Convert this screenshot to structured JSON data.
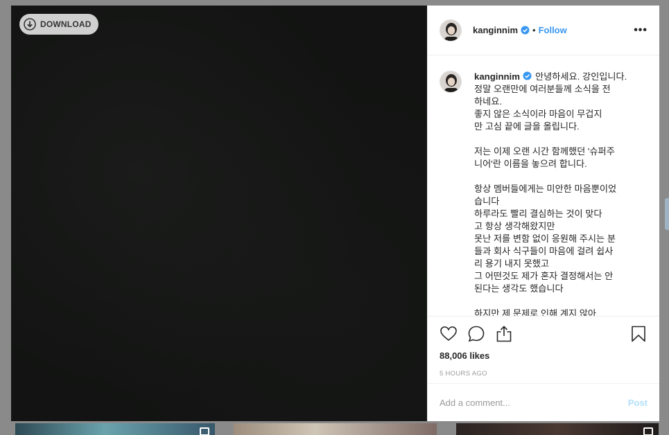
{
  "download": {
    "label": "DOWNLOAD"
  },
  "post": {
    "username": "kanginnim",
    "follow_label": "Follow",
    "separator": "•",
    "more_label": "•••",
    "caption_lines": [
      "안녕하세요. 강인입니다.",
      "정말 오랜만에 여러분들께 소식을 전",
      "하네요.",
      "좋지 않은 소식이라 마음이 무겁지",
      "만 고심 끝에 글을 올립니다.",
      "",
      "저는 이제 오랜 시간 함께했던 '슈퍼주",
      "니어'란 이름을 놓으려 합니다.",
      "",
      "항상 멤버들에게는 미안한 마음뿐이었",
      "습니다",
      "하루라도 빨리 결심하는 것이 맞다",
      "고 항상 생각해왔지만",
      "못난 저를 변함 없이 응원해 주시는 분",
      "들과 회사 식구들이 마음에 걸려 쉽사",
      "리 용기 내지 못했고",
      "그 어떤것도 제가 혼자 결정해서는 안",
      "된다는 생각도 했습니다",
      "",
      "하지만 제 문제로 인해 계지 않아"
    ],
    "likes": "88,006 likes",
    "timestamp": "5 HOURS AGO"
  },
  "comment": {
    "placeholder": "Add a comment...",
    "post_label": "Post"
  },
  "colors": {
    "accent": "#3897f0",
    "post_disabled": "#b2dffc",
    "verified": "#3897f0",
    "media_bg": "#121312"
  },
  "icons": [
    "download-icon",
    "verified-badge-icon",
    "heart-icon",
    "comment-icon",
    "share-icon",
    "bookmark-icon",
    "more-icon"
  ]
}
